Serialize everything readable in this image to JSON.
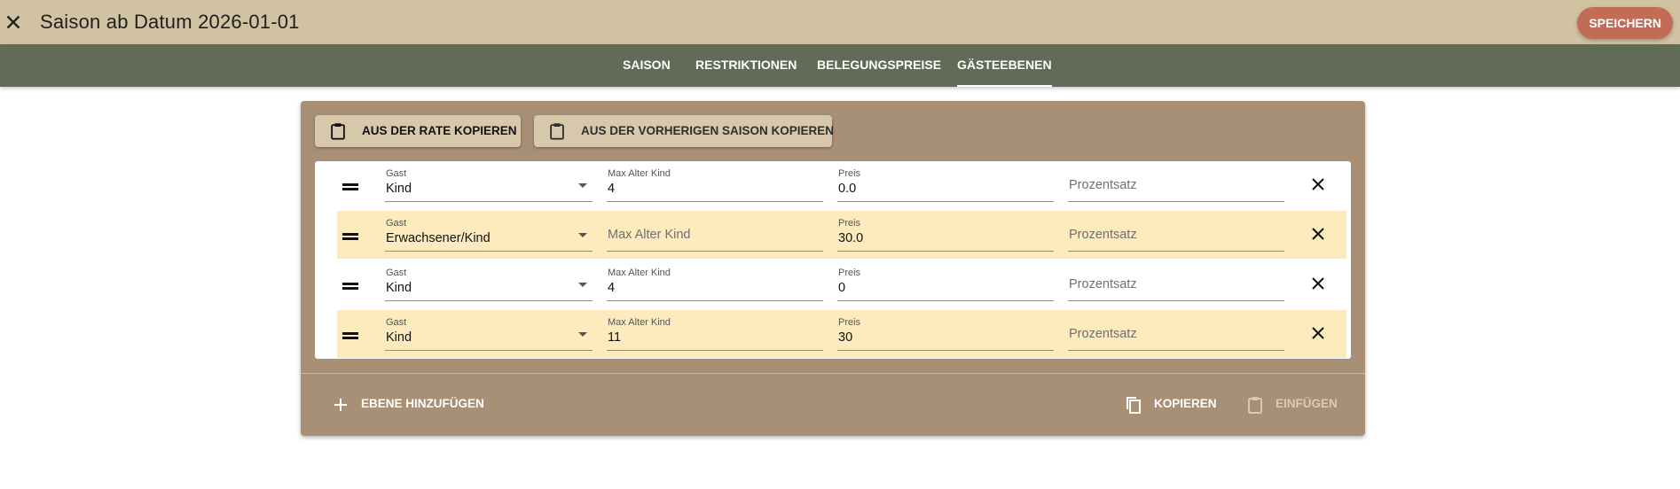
{
  "header": {
    "title": "Saison ab Datum 2026-01-01",
    "close_icon": "close-icon",
    "save_label": "SPEICHERN",
    "colors": {
      "bar": "#d1c2a1",
      "save": "#c26b55"
    }
  },
  "tabs": [
    {
      "label": "SAISON",
      "active": false
    },
    {
      "label": "RESTRIKTIONEN",
      "active": false
    },
    {
      "label": "BELEGUNGSPREISE",
      "active": false
    },
    {
      "label": "GÄSTEEBENEN",
      "active": true
    }
  ],
  "panel": {
    "copy_from_rate_label": "AUS DER RATE KOPIEREN",
    "copy_from_prev_label": "AUS DER VORHERIGEN SAISON KOPIEREN",
    "rows": [
      {
        "guest_label": "Gast",
        "guest_value": "Kind",
        "age_label": "Max Alter Kind",
        "age_value": "4",
        "price_label": "Preis",
        "price_value": "0.0",
        "percent_placeholder": "Prozentsatz"
      },
      {
        "guest_label": "Gast",
        "guest_value": "Erwachsener/Kind",
        "age_label": "",
        "age_value": "",
        "age_placeholder": "Max Alter Kind",
        "price_label": "Preis",
        "price_value": "30.0",
        "percent_placeholder": "Prozentsatz"
      },
      {
        "guest_label": "Gast",
        "guest_value": "Kind",
        "age_label": "Max Alter Kind",
        "age_value": "4",
        "price_label": "Preis",
        "price_value": "0",
        "percent_placeholder": "Prozentsatz"
      },
      {
        "guest_label": "Gast",
        "guest_value": "Kind",
        "age_label": "Max Alter Kind",
        "age_value": "11",
        "price_label": "Preis",
        "price_value": "30",
        "percent_placeholder": "Prozentsatz"
      }
    ],
    "add_level_label": "EBENE HINZUFÜGEN",
    "copy_label": "KOPIEREN",
    "paste_label": "EINFÜGEN",
    "colors": {
      "panel": "#a79075",
      "row_alt": "#fdebbd",
      "tabs": "#616b58"
    }
  }
}
